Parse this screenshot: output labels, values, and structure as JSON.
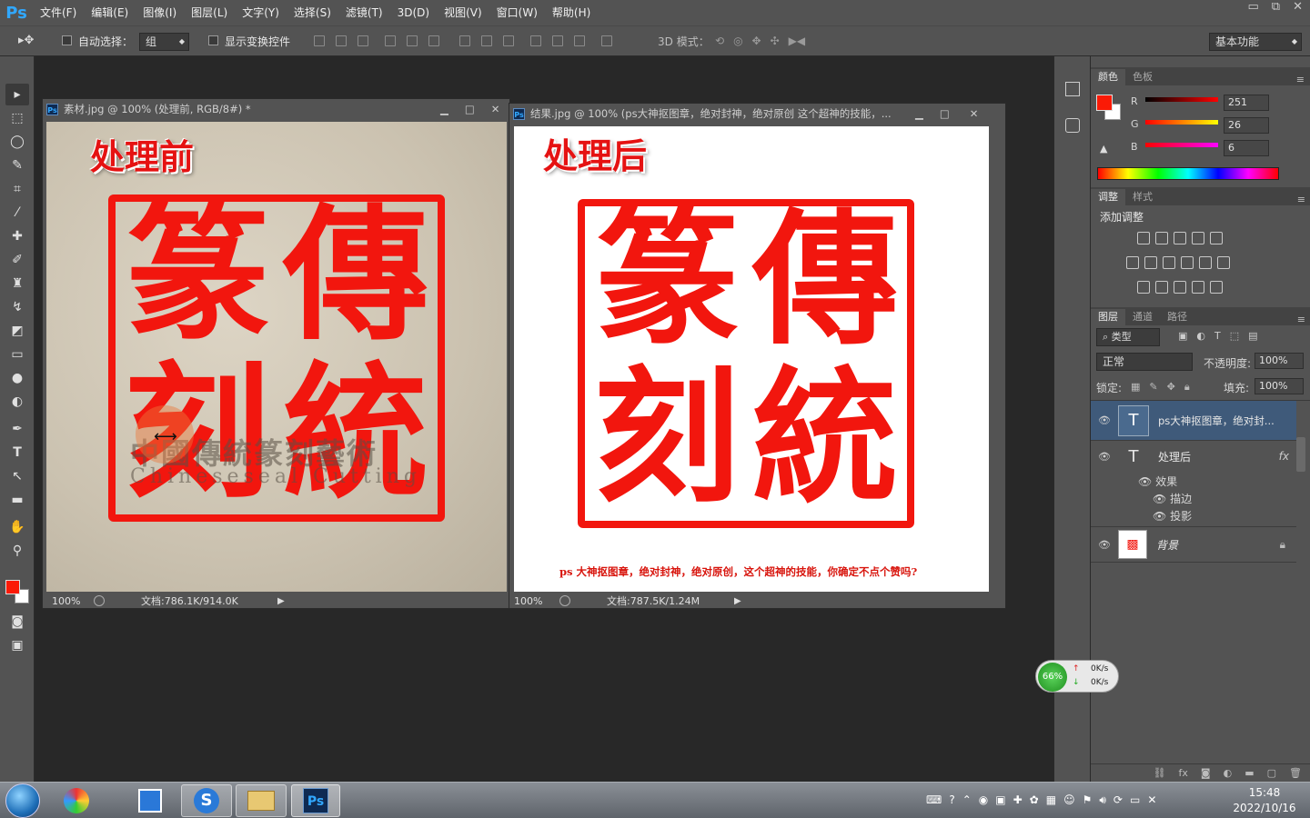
{
  "app": {
    "logo": "Ps"
  },
  "menu": [
    "文件(F)",
    "编辑(E)",
    "图像(I)",
    "图层(L)",
    "文字(Y)",
    "选择(S)",
    "滤镜(T)",
    "3D(D)",
    "视图(V)",
    "窗口(W)",
    "帮助(H)"
  ],
  "window_controls": {
    "minimize": "▭",
    "restore": "⧉",
    "close": "✕"
  },
  "options": {
    "auto_select_label": "自动选择：",
    "auto_select_value": "组",
    "show_transform_label": "显示变换控件",
    "mode_3d_label": "3D 模式：",
    "workspace": "基本功能"
  },
  "doc1": {
    "title": "素材.jpg @ 100% (处理前, RGB/8#) *",
    "heading": "处理前",
    "seal_chars": [
      "傳",
      "統",
      "篆",
      "刻"
    ],
    "watermark_cn": "中國傳統篆刻藝術",
    "watermark_en": "Chineseseal Cutting",
    "zoom": "100%",
    "doc_size": "文档:786.1K/914.0K"
  },
  "doc2": {
    "title": "结果.jpg @ 100% (ps大神抠图章，绝对封神，绝对原创 这个超神的技能，...",
    "heading": "处理后",
    "seal_chars": [
      "傳",
      "統",
      "篆",
      "刻"
    ],
    "caption": "ps 大神抠图章，绝对封神，绝对原创，这个超神的技能，你确定不点个赞吗?",
    "zoom": "100%",
    "doc_size": "文档:787.5K/1.24M"
  },
  "color_panel": {
    "tabs": [
      "颜色",
      "色板"
    ],
    "r_label": "R",
    "g_label": "G",
    "b_label": "B",
    "r": "251",
    "g": "26",
    "b": "6",
    "foreground": "#fb1a06"
  },
  "adjust_panel": {
    "tabs": [
      "调整",
      "样式"
    ],
    "title": "添加调整"
  },
  "layers_panel": {
    "tabs": [
      "图层",
      "通道",
      "路径"
    ],
    "filter_kind": "类型",
    "blend_mode": "正常",
    "opacity_label": "不透明度:",
    "opacity": "100%",
    "lock_label": "锁定:",
    "fill_label": "填充:",
    "fill": "100%",
    "layers": [
      {
        "name": "ps大神抠图章，绝对封...",
        "type": "T"
      },
      {
        "name": "处理后",
        "type": "T",
        "fx": "fx"
      },
      {
        "name": "背景",
        "type": "image"
      }
    ],
    "effects_label": "效果",
    "effects": [
      "描边",
      "投影"
    ]
  },
  "net_widget": {
    "percent": "66%",
    "up": "0K/s",
    "down": "0K/s"
  },
  "clock": {
    "time": "15:48",
    "date": "2022/10/16"
  }
}
